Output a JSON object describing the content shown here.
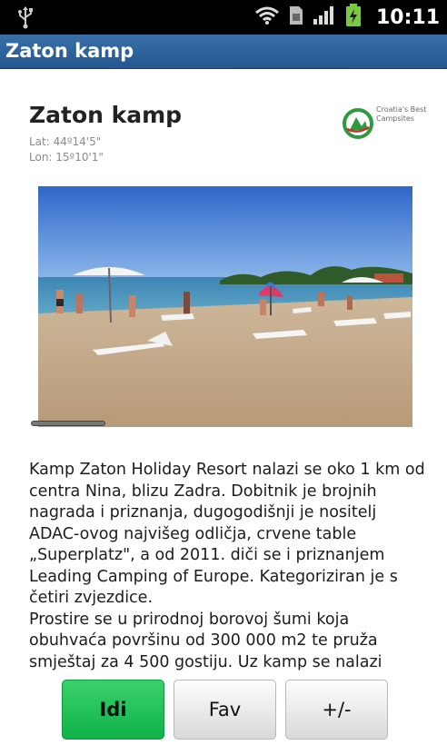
{
  "status_bar": {
    "time": "10:11",
    "icons": [
      "usb-icon",
      "wifi-icon",
      "sim-icon",
      "signal-icon",
      "battery-charging-icon"
    ]
  },
  "app": {
    "title": "Zaton kamp"
  },
  "camp": {
    "name": "Zaton kamp",
    "lat": "Lat: 44º14'5\"",
    "lon": "Lon: 15º10'1\"",
    "logo_text": "Croatia's Best Campsites",
    "description": "Kamp Zaton Holiday Resort nalazi se oko 1 km od centra Nina, blizu Zadra. Dobitnik je brojnih nagrada i priznanja, dugogodišnji je nositelj ADAC-ovog najvišeg odličja, crvene table „Superplatz\", a od 2011. diči se i priznanjem Leading Camping of Europe. Kategoriziran je s četiri zvjezdice.\nProstire se u prirodnoj borovoj šumi koja obuhvaća površinu od 300 000 m2 te pruža smještaj za 4 500 gostiju. Uz kamp se nalazi"
  },
  "buttons": {
    "go": "Idi",
    "fav": "Fav",
    "zoom": "+/-"
  },
  "colors": {
    "title_bar": "#2c62a0",
    "go_button": "#22c35a"
  }
}
